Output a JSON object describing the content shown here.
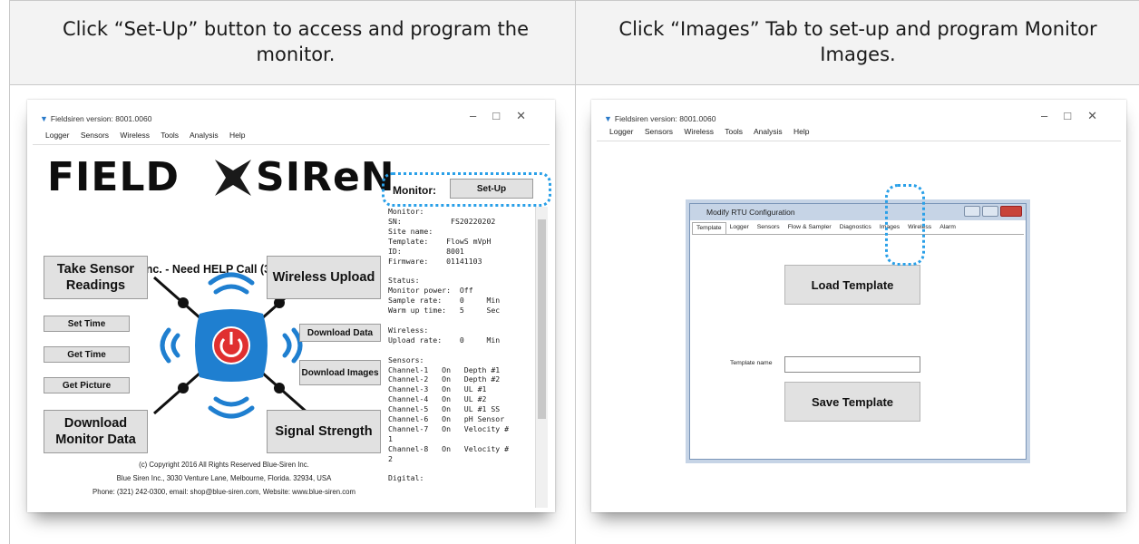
{
  "captions": {
    "left": "Click “Set-Up” button to access and program the monitor.",
    "right": "Click “Images” Tab to set-up and program Monitor Images."
  },
  "left_window": {
    "title": "Fieldsiren version: 8001.0060",
    "menu": [
      "Logger",
      "Sensors",
      "Wireless",
      "Tools",
      "Analysis",
      "Help"
    ],
    "logo_left": "FIELD",
    "logo_right": "SIReN",
    "help_line": "Blue Siren Inc. - Need HELP Call (321) 242-0300",
    "buttons": {
      "take_sensor": "Take Sensor Readings",
      "wireless_upload": "Wireless Upload",
      "set_time": "Set Time",
      "get_time": "Get Time",
      "get_picture": "Get Picture",
      "download_data": "Download Data",
      "download_images": "Download Images",
      "download_monitor": "Download Monitor Data",
      "signal_strength": "Signal Strength"
    },
    "monitor_label": "Monitor:",
    "setup_label": "Set-Up",
    "console": "Monitor:\nSN:           FS20220202\nSite name:\nTemplate:    FlowS mVpH\nID:          8001\nFirmware:    01141103\n\nStatus:\nMonitor power:  Off\nSample rate:    0     Min\nWarm up time:   5     Sec\n\nWireless:\nUpload rate:    0     Min\n\nSensors:\nChannel-1   On   Depth #1\nChannel-2   On   Depth #2\nChannel-3   On   UL #1\nChannel-4   On   UL #2\nChannel-5   On   UL #1 SS\nChannel-6   On   pH Sensor\nChannel-7   On   Velocity #\n1\nChannel-8   On   Velocity #\n2\n\nDigital:",
    "copyright": [
      "(c) Copyright 2016 All Rights Reserved Blue-Siren Inc.",
      "Blue Siren Inc., 3030 Venture Lane, Melbourne, Florida. 32934, USA",
      "Phone: (321) 242-0300, email: shop@blue-siren.com, Website: www.blue-siren.com"
    ]
  },
  "right_window": {
    "title": "Fieldsiren version: 8001.0060",
    "menu": [
      "Logger",
      "Sensors",
      "Wireless",
      "Tools",
      "Analysis",
      "Help"
    ],
    "dialog_title": "Modify RTU Configuration",
    "tabs": [
      "Template",
      "Logger",
      "Sensors",
      "Flow & Sampler",
      "Diagnostics",
      "Images",
      "Wireless",
      "Alarm"
    ],
    "load_template": "Load Template",
    "template_name_label": "Template name",
    "template_name_value": "",
    "save_template": "Save Template"
  },
  "colors": {
    "accent_blue": "#2aa0e8",
    "power_red": "#e03030",
    "drone_blue": "#1f7fd0"
  }
}
